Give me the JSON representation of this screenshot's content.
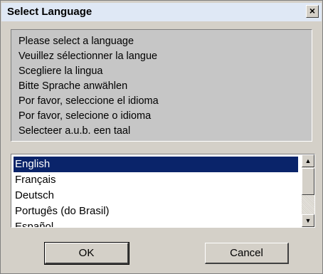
{
  "window": {
    "title": "Select Language",
    "close_label": "×"
  },
  "messages": [
    "Please select a language",
    "Veuillez sélectionner la langue",
    "Scegliere la lingua",
    "Bitte Sprache anwählen",
    "Por favor, seleccione el idioma",
    "Por favor, selecione o idioma",
    "Selecteer a.u.b. een taal"
  ],
  "languages": {
    "selected": "English",
    "items": [
      "English",
      "Français",
      "Deutsch",
      "Portugês (do Brasil)",
      "Español"
    ]
  },
  "scrollbar": {
    "up_glyph": "▲",
    "down_glyph": "▼"
  },
  "buttons": {
    "ok": "OK",
    "cancel": "Cancel"
  },
  "colors": {
    "selection": "#0a246a",
    "dialog_bg": "#d4d0c8"
  }
}
